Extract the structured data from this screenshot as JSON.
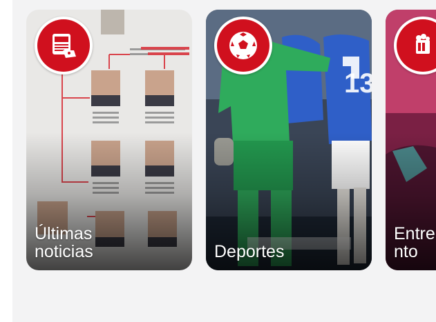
{
  "categories": [
    {
      "label": "Últimas\nnoticias",
      "icon": "news-icon"
    },
    {
      "label": "Deportes",
      "icon": "soccer-ball-icon"
    },
    {
      "label": "Entre\nnto",
      "icon": "entertainment-icon"
    }
  ],
  "colors": {
    "accent": "#d0101e",
    "panel_background": "#f3f3f4",
    "label_text": "#ffffff"
  }
}
